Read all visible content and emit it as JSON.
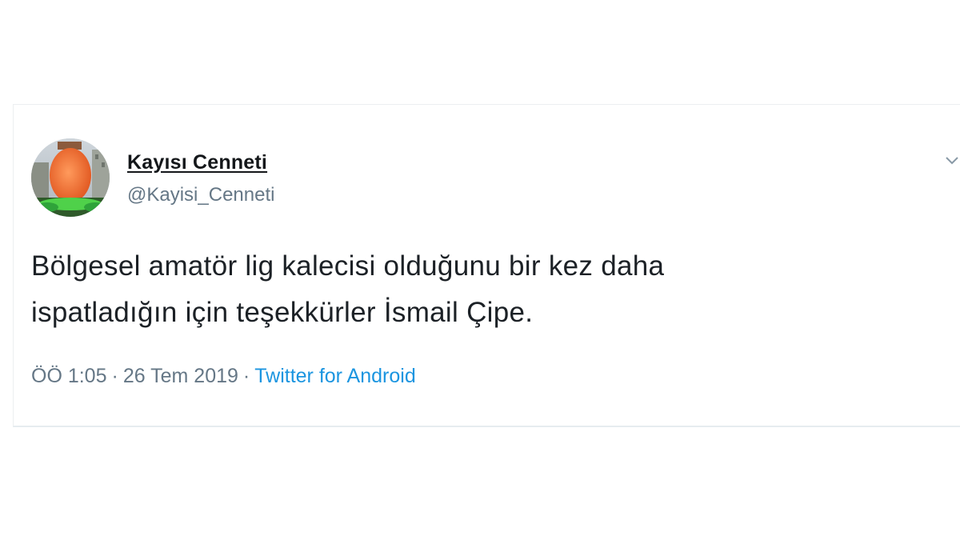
{
  "tweet": {
    "author": {
      "display_name": "Kayısı Cenneti",
      "handle": "@Kayisi_Cenneti",
      "avatar_icon": "profile-photo-apricot-monument"
    },
    "text": "Bölgesel amatör lig kalecisi olduğunu bir kez daha\nispatladığın için teşekkürler İsmail Çipe.",
    "time": "ÖÖ 1:05",
    "date": "26 Tem 2019",
    "separator": "·",
    "source": "Twitter for Android",
    "menu_icon": "chevron-down-icon"
  },
  "colors": {
    "name": "#14171a",
    "handle": "#657786",
    "text": "#1c2126",
    "link": "#1b95e0",
    "border": "#e6ecf0"
  }
}
